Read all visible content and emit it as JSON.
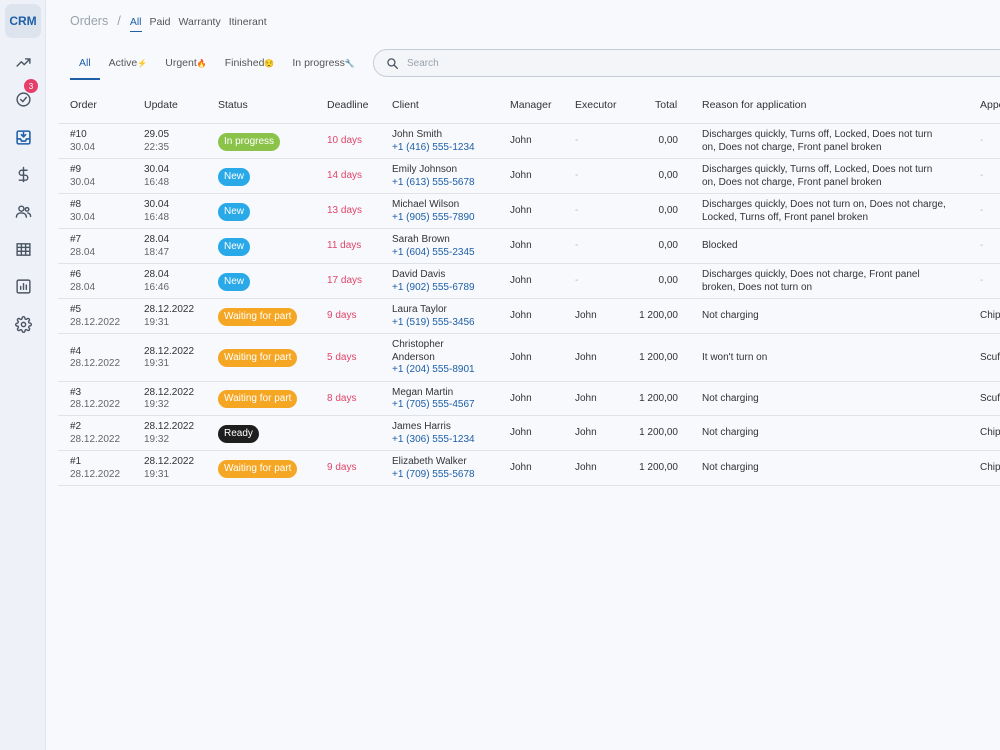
{
  "sidebar": {
    "logo": "CRM",
    "badge_count": "3",
    "icons": [
      "trending-up-icon",
      "check-circle-icon",
      "inbox-download-icon",
      "dollar-icon",
      "users-icon",
      "grid-table-icon",
      "bar-chart-icon",
      "gear-icon"
    ],
    "active_color": "#1f5fa8"
  },
  "breadcrumb": {
    "root": "Orders",
    "separator": "/",
    "tabs": [
      "All",
      "Paid",
      "Warranty",
      "Itinerant"
    ]
  },
  "filters": [
    {
      "label": "All",
      "emoji": ""
    },
    {
      "label": "Active",
      "emoji": "⚡"
    },
    {
      "label": "Urgent",
      "emoji": "🔥"
    },
    {
      "label": "Finished",
      "emoji": "😌"
    },
    {
      "label": "In progress",
      "emoji": "🔧"
    }
  ],
  "search": {
    "placeholder": "Search"
  },
  "columns": [
    "Order",
    "Update",
    "Status",
    "Deadline",
    "Client",
    "Manager",
    "Executor",
    "Total",
    "Reason for application",
    "Appearance"
  ],
  "status_colors": {
    "In progress": "#8bc34a",
    "New": "#29a9e8",
    "Waiting for part": "#f5a623",
    "Ready": "#1e1e1e"
  },
  "rows": [
    {
      "order": "#10",
      "order_date": "30.04",
      "update_date": "29.05",
      "update_time": "22:35",
      "status": "In progress",
      "deadline": "10 days",
      "client_lines": [
        "John Smith"
      ],
      "phone": "+1 (416) 555-1234",
      "manager": "John",
      "executor": "-",
      "total": "0,00",
      "reason_lines": [
        "Discharges quickly, Turns off, Locked, Does not turn",
        "on, Does not charge, Front panel broken"
      ],
      "appearance": "-"
    },
    {
      "order": "#9",
      "order_date": "30.04",
      "update_date": "30.04",
      "update_time": "16:48",
      "status": "New",
      "deadline": "14 days",
      "client_lines": [
        "Emily Johnson"
      ],
      "phone": "+1 (613) 555-5678",
      "manager": "John",
      "executor": "-",
      "total": "0,00",
      "reason_lines": [
        "Discharges quickly, Turns off, Locked, Does not turn",
        "on, Does not charge, Front panel broken"
      ],
      "appearance": "-"
    },
    {
      "order": "#8",
      "order_date": "30.04",
      "update_date": "30.04",
      "update_time": "16:48",
      "status": "New",
      "deadline": "13 days",
      "client_lines": [
        "Michael Wilson"
      ],
      "phone": "+1 (905) 555-7890",
      "manager": "John",
      "executor": "-",
      "total": "0,00",
      "reason_lines": [
        "Discharges quickly, Does not turn on, Does not charge,",
        "Locked, Turns off, Front panel broken"
      ],
      "appearance": "-"
    },
    {
      "order": "#7",
      "order_date": "28.04",
      "update_date": "28.04",
      "update_time": "18:47",
      "status": "New",
      "deadline": "11 days",
      "client_lines": [
        "Sarah Brown"
      ],
      "phone": "+1 (604) 555-2345",
      "manager": "John",
      "executor": "-",
      "total": "0,00",
      "reason_lines": [
        "Blocked"
      ],
      "appearance": "-"
    },
    {
      "order": "#6",
      "order_date": "28.04",
      "update_date": "28.04",
      "update_time": "16:46",
      "status": "New",
      "deadline": "17 days",
      "client_lines": [
        "David Davis"
      ],
      "phone": "+1 (902) 555-6789",
      "manager": "John",
      "executor": "-",
      "total": "0,00",
      "reason_lines": [
        "Discharges quickly, Does not charge, Front panel",
        "broken, Does not turn on"
      ],
      "appearance": "-"
    },
    {
      "order": "#5",
      "order_date": "28.12.2022",
      "update_date": "28.12.2022",
      "update_time": "19:31",
      "status": "Waiting for part",
      "deadline": "9 days",
      "client_lines": [
        "Laura Taylor"
      ],
      "phone": "+1 (519) 555-3456",
      "manager": "John",
      "executor": "John",
      "total": "1 200,00",
      "reason_lines": [
        "Not charging"
      ],
      "appearance": "Chip"
    },
    {
      "order": "#4",
      "order_date": "28.12.2022",
      "update_date": "28.12.2022",
      "update_time": "19:31",
      "status": "Waiting for part",
      "deadline": "5 days",
      "client_lines": [
        "Christopher",
        "Anderson"
      ],
      "phone": "+1 (204) 555-8901",
      "manager": "John",
      "executor": "John",
      "total": "1 200,00",
      "reason_lines": [
        "It won't turn on"
      ],
      "appearance": "Scuf"
    },
    {
      "order": "#3",
      "order_date": "28.12.2022",
      "update_date": "28.12.2022",
      "update_time": "19:32",
      "status": "Waiting for part",
      "deadline": "8 days",
      "client_lines": [
        "Megan Martin"
      ],
      "phone": "+1 (705) 555-4567",
      "manager": "John",
      "executor": "John",
      "total": "1 200,00",
      "reason_lines": [
        "Not charging"
      ],
      "appearance": "Scuf"
    },
    {
      "order": "#2",
      "order_date": "28.12.2022",
      "update_date": "28.12.2022",
      "update_time": "19:32",
      "status": "Ready",
      "deadline": "",
      "client_lines": [
        "James Harris"
      ],
      "phone": "+1 (306) 555-1234",
      "manager": "John",
      "executor": "John",
      "total": "1 200,00",
      "reason_lines": [
        "Not charging"
      ],
      "appearance": "Chip"
    },
    {
      "order": "#1",
      "order_date": "28.12.2022",
      "update_date": "28.12.2022",
      "update_time": "19:31",
      "status": "Waiting for part",
      "deadline": "9 days",
      "client_lines": [
        "Elizabeth Walker"
      ],
      "phone": "+1 (709) 555-5678",
      "manager": "John",
      "executor": "John",
      "total": "1 200,00",
      "reason_lines": [
        "Not charging"
      ],
      "appearance": "Chip"
    }
  ]
}
